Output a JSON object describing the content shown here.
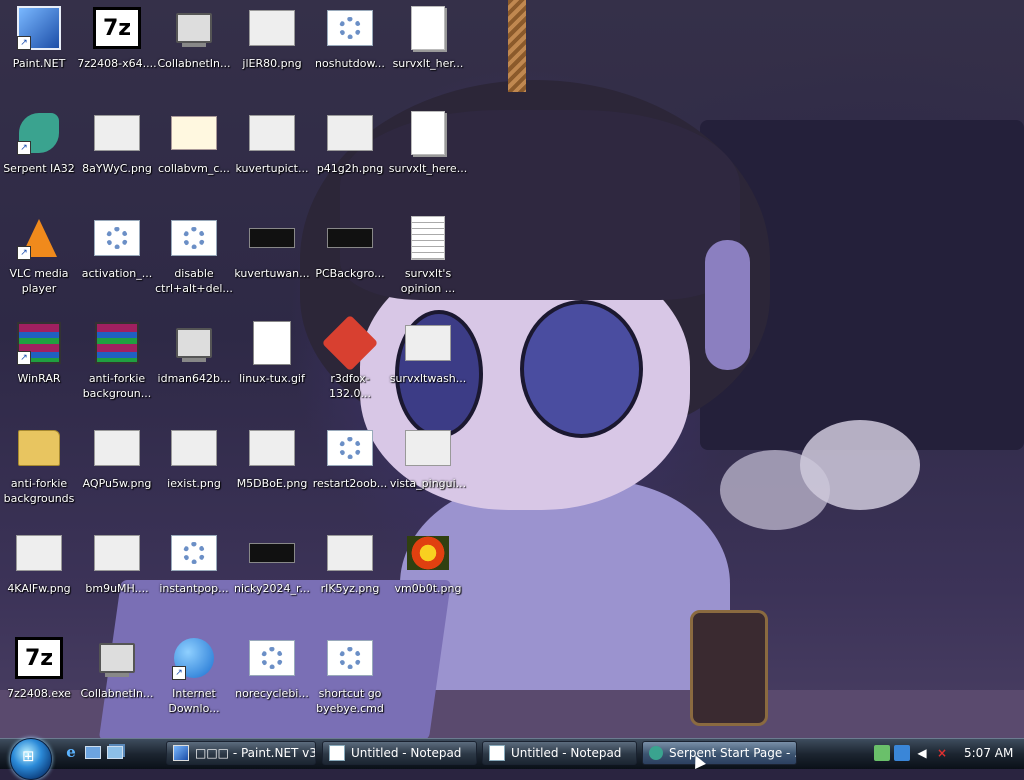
{
  "desktop": {
    "icons": [
      {
        "label": "Paint.NET",
        "art": "paint-net-icon",
        "shortcut": true
      },
      {
        "label": "7z2408-x64....",
        "art": "7zip-icon",
        "shortcut": false
      },
      {
        "label": "CollabnetIn...",
        "art": "computer-icon",
        "shortcut": false
      },
      {
        "label": "jlER80.png",
        "art": "image-thumbnail-icon",
        "shortcut": false
      },
      {
        "label": "noshutdow...",
        "art": "registry-settings-icon",
        "shortcut": false
      },
      {
        "label": "survxlt_her...",
        "art": "blank-document-icon",
        "shortcut": false
      },
      {
        "label": "Serpent IA32",
        "art": "serpent-dragon-icon",
        "shortcut": true
      },
      {
        "label": "8aYWyC.png",
        "art": "image-thumbnail-icon",
        "shortcut": false
      },
      {
        "label": "collabvm_c...",
        "art": "certificate-icon",
        "shortcut": false
      },
      {
        "label": "kuvertupict...",
        "art": "image-thumbnail-icon",
        "shortcut": false
      },
      {
        "label": "p41g2h.png",
        "art": "image-thumbnail-icon",
        "shortcut": false
      },
      {
        "label": "survxlt_here...",
        "art": "blank-document-icon",
        "shortcut": false
      },
      {
        "label": "VLC media\nplayer",
        "art": "vlc-cone-icon",
        "shortcut": true
      },
      {
        "label": "activation_...",
        "art": "registry-settings-icon",
        "shortcut": false
      },
      {
        "label": "disable\nctrl+alt+del...",
        "art": "registry-settings-icon",
        "shortcut": false
      },
      {
        "label": "kuvertuwan...",
        "art": "dark-image-icon",
        "shortcut": false
      },
      {
        "label": "PCBackgro...",
        "art": "dark-image-icon",
        "shortcut": false
      },
      {
        "label": "survxlt's\nopinion ...",
        "art": "text-document-icon",
        "shortcut": false
      },
      {
        "label": "WinRAR",
        "art": "winrar-icon",
        "shortcut": true
      },
      {
        "label": "anti-forkie\nbackgroun...",
        "art": "winrar-icon",
        "shortcut": false
      },
      {
        "label": "idman642b...",
        "art": "installer-icon",
        "shortcut": false
      },
      {
        "label": "linux-tux.gif",
        "art": "tux-image-icon",
        "shortcut": false
      },
      {
        "label": "r3dfox-132.0...",
        "art": "firefox-icon",
        "shortcut": false
      },
      {
        "label": "survxltwash...",
        "art": "image-thumbnail-icon",
        "shortcut": false
      },
      {
        "label": "anti-forkie\nbackgrounds",
        "art": "folder-icon",
        "shortcut": false
      },
      {
        "label": "AQPu5w.png",
        "art": "image-thumbnail-icon",
        "shortcut": false
      },
      {
        "label": "iexist.png",
        "art": "image-thumbnail-icon",
        "shortcut": false
      },
      {
        "label": "M5DBoE.png",
        "art": "image-thumbnail-icon",
        "shortcut": false
      },
      {
        "label": "restart2oob...",
        "art": "registry-settings-icon",
        "shortcut": false
      },
      {
        "label": "vista_pingui...",
        "art": "image-thumbnail-icon",
        "shortcut": false
      },
      {
        "label": "4KAlFw.png",
        "art": "image-thumbnail-icon",
        "shortcut": false
      },
      {
        "label": "bm9uMH....",
        "art": "image-thumbnail-icon",
        "shortcut": false
      },
      {
        "label": "instantpop...",
        "art": "registry-settings-icon",
        "shortcut": false
      },
      {
        "label": "nicky2024_r...",
        "art": "dark-image-icon",
        "shortcut": false
      },
      {
        "label": "rIK5yz.png",
        "art": "image-thumbnail-icon",
        "shortcut": false
      },
      {
        "label": "vm0b0t.png",
        "art": "flower-image-icon",
        "shortcut": false
      },
      {
        "label": "7z2408.exe",
        "art": "7zip-icon",
        "shortcut": false
      },
      {
        "label": "CollabnetIn...",
        "art": "computer-icon",
        "shortcut": false
      },
      {
        "label": "Internet\nDownlo...",
        "art": "globe-icon",
        "shortcut": true
      },
      {
        "label": "norecyclebi...",
        "art": "registry-settings-icon",
        "shortcut": false
      },
      {
        "label": "shortcut go\nbyebye.cmd",
        "art": "registry-settings-icon",
        "shortcut": false
      }
    ]
  },
  "taskbar": {
    "start_label": "Start",
    "quick_launch": [
      {
        "name": "internet-explorer-icon",
        "glyph": "e"
      },
      {
        "name": "show-desktop-icon",
        "glyph": ""
      },
      {
        "name": "switch-windows-icon",
        "glyph": ""
      }
    ],
    "buttons": [
      {
        "label": "□□□ - Paint.NET v3.0",
        "icon": "paint-net-icon",
        "active": false
      },
      {
        "label": "Untitled - Notepad",
        "icon": "notepad-icon",
        "active": false
      },
      {
        "label": "Untitled - Notepad",
        "icon": "notepad-icon",
        "active": false
      },
      {
        "label": "Serpent Start Page - ...",
        "icon": "serpent-icon",
        "active": true
      }
    ],
    "tray": {
      "clock": "5:07 AM"
    }
  }
}
